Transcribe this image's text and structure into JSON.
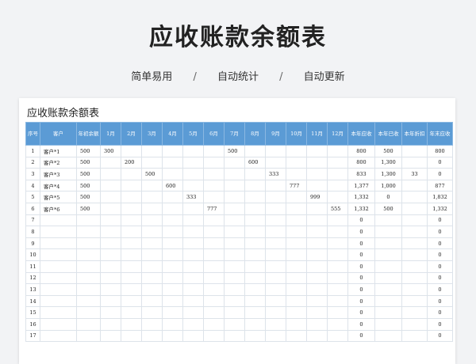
{
  "page": {
    "title": "应收账款余额表",
    "features": [
      "简单易用",
      "自动统计",
      "自动更新"
    ],
    "separator": "/"
  },
  "sheet": {
    "title": "应收账款余额表",
    "headers": [
      "序号",
      "客户",
      "年初余额",
      "1月",
      "2月",
      "3月",
      "4月",
      "5月",
      "6月",
      "7月",
      "8月",
      "9月",
      "10月",
      "11月",
      "12月",
      "本年应收",
      "本年已收",
      "本年折扣",
      "年末应收"
    ],
    "rows": [
      [
        "1",
        "客户*1",
        "500",
        "300",
        "",
        "",
        "",
        "",
        "",
        "500",
        "",
        "",
        "",
        "",
        "",
        "800",
        "500",
        "",
        "800"
      ],
      [
        "2",
        "客户*2",
        "500",
        "",
        "200",
        "",
        "",
        "",
        "",
        "",
        "600",
        "",
        "",
        "",
        "",
        "800",
        "1,300",
        "",
        "0"
      ],
      [
        "3",
        "客户*3",
        "500",
        "",
        "",
        "500",
        "",
        "",
        "",
        "",
        "",
        "333",
        "",
        "",
        "",
        "833",
        "1,300",
        "33",
        "0"
      ],
      [
        "4",
        "客户*4",
        "500",
        "",
        "",
        "",
        "600",
        "",
        "",
        "",
        "",
        "",
        "777",
        "",
        "",
        "1,377",
        "1,000",
        "",
        "877"
      ],
      [
        "5",
        "客户*5",
        "500",
        "",
        "",
        "",
        "",
        "333",
        "",
        "",
        "",
        "",
        "",
        "999",
        "",
        "1,332",
        "0",
        "",
        "1,832"
      ],
      [
        "6",
        "客户*6",
        "500",
        "",
        "",
        "",
        "",
        "",
        "777",
        "",
        "",
        "",
        "",
        "",
        "555",
        "1,332",
        "500",
        "",
        "1,332"
      ],
      [
        "7",
        "",
        "",
        "",
        "",
        "",
        "",
        "",
        "",
        "",
        "",
        "",
        "",
        "",
        "",
        "0",
        "",
        "",
        "0"
      ],
      [
        "8",
        "",
        "",
        "",
        "",
        "",
        "",
        "",
        "",
        "",
        "",
        "",
        "",
        "",
        "",
        "0",
        "",
        "",
        "0"
      ],
      [
        "9",
        "",
        "",
        "",
        "",
        "",
        "",
        "",
        "",
        "",
        "",
        "",
        "",
        "",
        "",
        "0",
        "",
        "",
        "0"
      ],
      [
        "10",
        "",
        "",
        "",
        "",
        "",
        "",
        "",
        "",
        "",
        "",
        "",
        "",
        "",
        "",
        "0",
        "",
        "",
        "0"
      ],
      [
        "11",
        "",
        "",
        "",
        "",
        "",
        "",
        "",
        "",
        "",
        "",
        "",
        "",
        "",
        "",
        "0",
        "",
        "",
        "0"
      ],
      [
        "12",
        "",
        "",
        "",
        "",
        "",
        "",
        "",
        "",
        "",
        "",
        "",
        "",
        "",
        "",
        "0",
        "",
        "",
        "0"
      ],
      [
        "13",
        "",
        "",
        "",
        "",
        "",
        "",
        "",
        "",
        "",
        "",
        "",
        "",
        "",
        "",
        "0",
        "",
        "",
        "0"
      ],
      [
        "14",
        "",
        "",
        "",
        "",
        "",
        "",
        "",
        "",
        "",
        "",
        "",
        "",
        "",
        "",
        "0",
        "",
        "",
        "0"
      ],
      [
        "15",
        "",
        "",
        "",
        "",
        "",
        "",
        "",
        "",
        "",
        "",
        "",
        "",
        "",
        "",
        "0",
        "",
        "",
        "0"
      ],
      [
        "16",
        "",
        "",
        "",
        "",
        "",
        "",
        "",
        "",
        "",
        "",
        "",
        "",
        "",
        "",
        "0",
        "",
        "",
        "0"
      ],
      [
        "17",
        "",
        "",
        "",
        "",
        "",
        "",
        "",
        "",
        "",
        "",
        "",
        "",
        "",
        "",
        "0",
        "",
        "",
        "0"
      ]
    ]
  }
}
